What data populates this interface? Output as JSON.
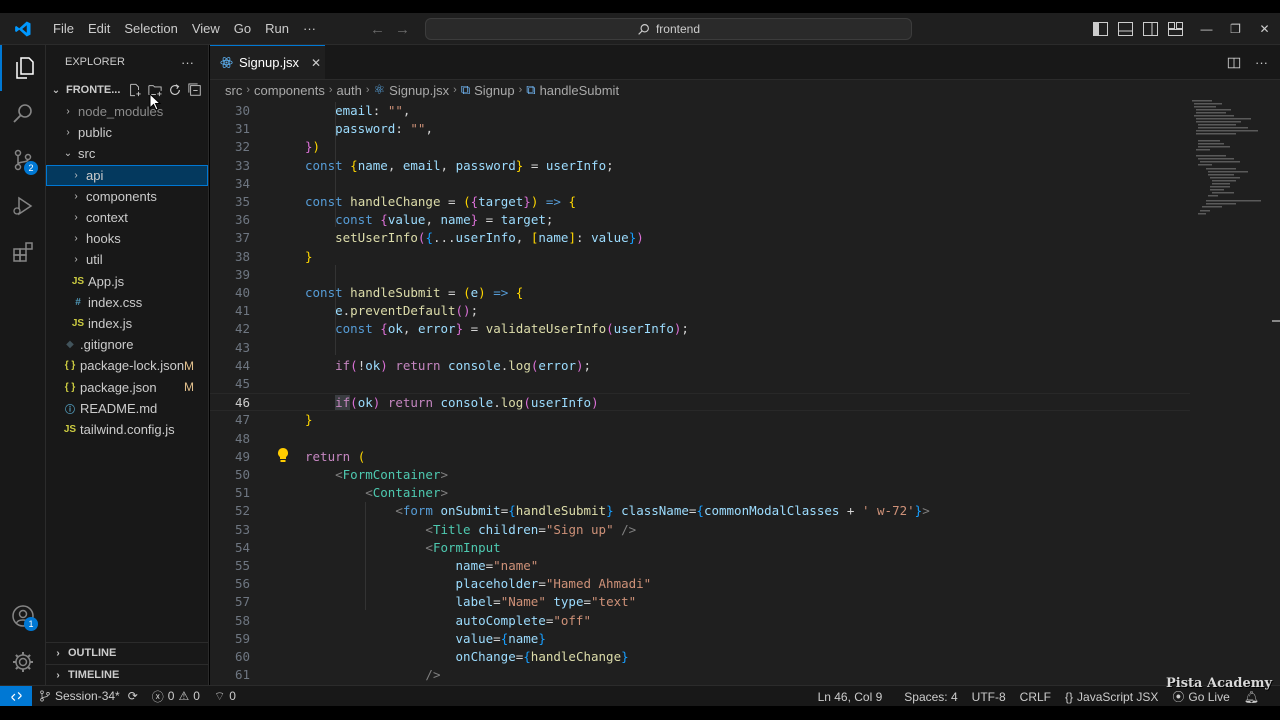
{
  "titlebar": {
    "menus": [
      "File",
      "Edit",
      "Selection",
      "View",
      "Go",
      "Run",
      "···"
    ],
    "command_center": "frontend"
  },
  "activity_bar": {
    "source_control_badge": "2",
    "accounts_badge": "1"
  },
  "sidebar": {
    "header": "EXPLORER",
    "more": "···",
    "root": "FRONTE...",
    "items": [
      {
        "label": "node_modules",
        "kind": "folder",
        "depth": 1,
        "open": false,
        "dim": true
      },
      {
        "label": "public",
        "kind": "folder",
        "depth": 1,
        "open": false
      },
      {
        "label": "src",
        "kind": "folder",
        "depth": 1,
        "open": true
      },
      {
        "label": "api",
        "kind": "folder",
        "depth": 2,
        "open": false,
        "selected": true
      },
      {
        "label": "components",
        "kind": "folder",
        "depth": 2,
        "open": false
      },
      {
        "label": "context",
        "kind": "folder",
        "depth": 2,
        "open": false
      },
      {
        "label": "hooks",
        "kind": "folder",
        "depth": 2,
        "open": false
      },
      {
        "label": "util",
        "kind": "folder",
        "depth": 2,
        "open": false
      },
      {
        "label": "App.js",
        "kind": "js",
        "depth": 2
      },
      {
        "label": "index.css",
        "kind": "css",
        "depth": 2
      },
      {
        "label": "index.js",
        "kind": "js",
        "depth": 2
      },
      {
        "label": ".gitignore",
        "kind": "git",
        "depth": 1
      },
      {
        "label": "package-lock.json",
        "kind": "json",
        "depth": 1,
        "git": "M"
      },
      {
        "label": "package.json",
        "kind": "json",
        "depth": 1,
        "git": "M"
      },
      {
        "label": "README.md",
        "kind": "md",
        "depth": 1
      },
      {
        "label": "tailwind.config.js",
        "kind": "js",
        "depth": 1
      }
    ],
    "outline": "OUTLINE",
    "timeline": "TIMELINE"
  },
  "editor": {
    "tab": "Signup.jsx",
    "breadcrumb": [
      "src",
      "components",
      "auth",
      "Signup.jsx",
      "Signup",
      "handleSubmit"
    ],
    "current_line": 46,
    "first_line": 30
  },
  "status_bar": {
    "branch": "Session-34*",
    "errors": "0",
    "warnings": "0",
    "ports": "0",
    "position": "Ln 46, Col 9",
    "spaces": "Spaces: 4",
    "encoding": "UTF-8",
    "eol": "CRLF",
    "language": "JavaScript JSX",
    "go_live": "Go Live"
  },
  "watermark": "Pista Academy",
  "colors": {
    "accent": "#0078d4",
    "editor_bg": "#1f1f1f",
    "sidebar_bg": "#181818",
    "selected_bg": "#04395e",
    "git_modified": "#e2c08d"
  }
}
